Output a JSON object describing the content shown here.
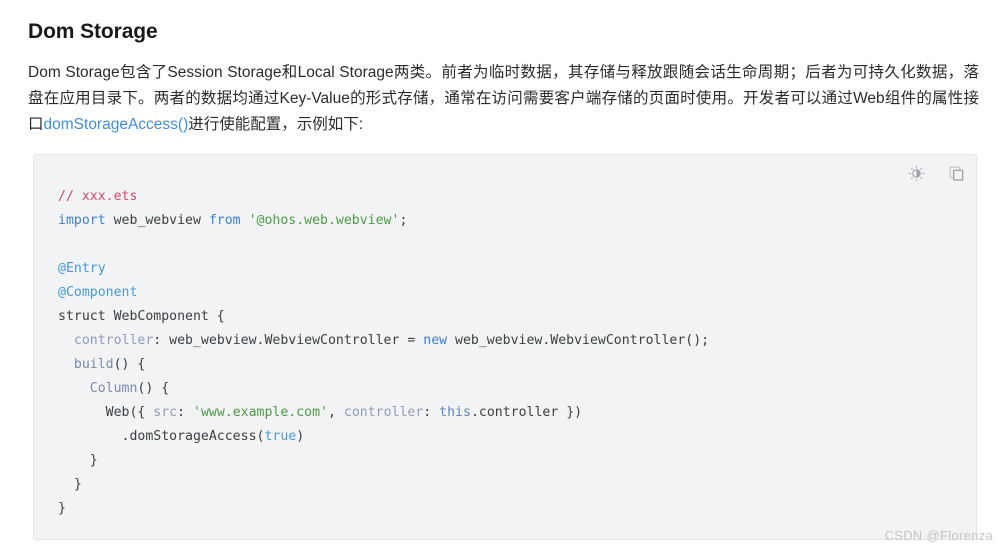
{
  "page": {
    "title": "Dom Storage",
    "paragraph_prefix": "Dom Storage包含了Session Storage和Local Storage两类。前者为临时数据，其存储与释放跟随会话生命周期；后者为可持久化数据，落盘在应用目录下。两者的数据均通过Key-Value的形式存储，通常在访问需要客户端存储的页面时使用。开发者可以通过Web组件的属性接口",
    "paragraph_link": "domStorageAccess()",
    "paragraph_suffix": "进行使能配置，示例如下:",
    "link_color": "#3f8ee0"
  },
  "code_block": {
    "background": "#f1f3f4",
    "border_color": "#e4e7ea",
    "language": "ets",
    "toolbar": {
      "theme_toggle_title": "brightness-icon",
      "copy_title": "copy-icon"
    },
    "lines": [
      {
        "indent": 0,
        "tokens": [
          {
            "t": "// xxx.ets",
            "c": "t-comment"
          }
        ]
      },
      {
        "indent": 0,
        "tokens": [
          {
            "t": "import",
            "c": "t-keyword"
          },
          {
            "t": " web_webview ",
            "c": "t-plain"
          },
          {
            "t": "from",
            "c": "t-keyword"
          },
          {
            "t": " ",
            "c": "t-plain"
          },
          {
            "t": "'@ohos.web.webview'",
            "c": "t-string"
          },
          {
            "t": ";",
            "c": "t-plain"
          }
        ]
      },
      {
        "indent": 0,
        "tokens": []
      },
      {
        "indent": 0,
        "tokens": [
          {
            "t": "@Entry",
            "c": "t-decorator"
          }
        ]
      },
      {
        "indent": 0,
        "tokens": [
          {
            "t": "@Component",
            "c": "t-decorator"
          }
        ]
      },
      {
        "indent": 0,
        "tokens": [
          {
            "t": "struct WebComponent {",
            "c": "t-plain"
          }
        ]
      },
      {
        "indent": 1,
        "tokens": [
          {
            "t": "controller",
            "c": "t-prop"
          },
          {
            "t": ": web_webview.WebviewController = ",
            "c": "t-plain"
          },
          {
            "t": "new",
            "c": "t-keyword"
          },
          {
            "t": " web_webview.WebviewController();",
            "c": "t-plain"
          }
        ]
      },
      {
        "indent": 1,
        "tokens": [
          {
            "t": "build",
            "c": "t-func"
          },
          {
            "t": "() {",
            "c": "t-plain"
          }
        ]
      },
      {
        "indent": 2,
        "tokens": [
          {
            "t": "Column",
            "c": "t-func"
          },
          {
            "t": "() {",
            "c": "t-plain"
          }
        ]
      },
      {
        "indent": 3,
        "tokens": [
          {
            "t": "Web({ ",
            "c": "t-plain"
          },
          {
            "t": "src",
            "c": "t-prop"
          },
          {
            "t": ": ",
            "c": "t-plain"
          },
          {
            "t": "'www.example.com'",
            "c": "t-string"
          },
          {
            "t": ", ",
            "c": "t-plain"
          },
          {
            "t": "controller",
            "c": "t-prop"
          },
          {
            "t": ": ",
            "c": "t-plain"
          },
          {
            "t": "this",
            "c": "t-this"
          },
          {
            "t": ".controller })",
            "c": "t-plain"
          }
        ]
      },
      {
        "indent": 4,
        "tokens": [
          {
            "t": ".domStorageAccess(",
            "c": "t-plain"
          },
          {
            "t": "true",
            "c": "t-bool"
          },
          {
            "t": ")",
            "c": "t-plain"
          }
        ]
      },
      {
        "indent": 2,
        "tokens": [
          {
            "t": "}",
            "c": "t-plain"
          }
        ]
      },
      {
        "indent": 1,
        "tokens": [
          {
            "t": "}",
            "c": "t-plain"
          }
        ]
      },
      {
        "indent": 0,
        "tokens": [
          {
            "t": "}",
            "c": "t-plain"
          }
        ]
      }
    ]
  },
  "watermark": {
    "text": "CSDN @Florenza"
  }
}
